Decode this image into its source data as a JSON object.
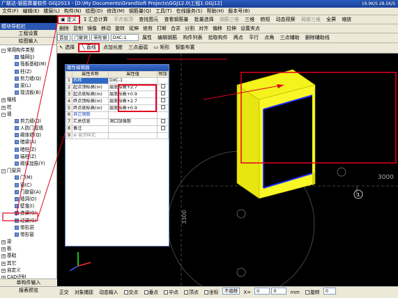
{
  "app": {
    "title": "广联达-钢筋算量软件 GGJ2013 - [D:\\My Documents\\GrandSoft Projects\\GGJ12.0\\工程1.GGJ12]",
    "net_down": "19.9K/S",
    "net_up": "28.5K/S"
  },
  "menu": [
    "文件(F)",
    "编辑(E)",
    "楼层(L)",
    "构件(N)",
    "绘图(D)",
    "修改(M)",
    "钢筋量(Q)",
    "工具(T)",
    "在线服务(S)",
    "帮助(H)",
    "版本号(B)"
  ],
  "toolbar1": {
    "define": "定义",
    "summary": "汇总计算",
    "flat_board": "平齐板顶",
    "find": "查找图元",
    "view_rebar": "查看钢筋量",
    "batch": "批量选择",
    "rebar_3d": "钢筋三维",
    "view3d": "三维",
    "top_view": "俯视",
    "dyn_view": "动态观察",
    "local_3d": "局部三维",
    "full": "全屏",
    "zoom": "缩放"
  },
  "toolbar2": [
    "删除",
    "复制",
    "镜像",
    "移动",
    "旋转",
    "延伸",
    "修剪",
    "打断",
    "合并",
    "分割",
    "对齐",
    "偏移",
    "拉伸",
    "设置夹点"
  ],
  "toolbar3": {
    "floor": "首层",
    "category": "门窗洞",
    "type": "带形窗",
    "item": "DXC-1",
    "property": "属性",
    "edit_rebar": "编辑钢筋",
    "comp_list": "构件列表",
    "pick": "拾取构件",
    "two_pt": "两点",
    "parallel": "平行",
    "point_angle": "点角",
    "three_pt_aux": "三点辅助",
    "del_aux": "删除辅助线"
  },
  "toolbar4": {
    "select": "选择",
    "line": "直线",
    "add_len": "点加长度",
    "three_arc": "三点画弧",
    "rect": "矩形",
    "smart": "智能布置"
  },
  "left": {
    "title": "模块导航栏",
    "tab1": "工程设置",
    "tab2": "绘图输入",
    "bottom1": "单构件输入",
    "bottom2": "报表预览",
    "tree": [
      {
        "t": "常用构件类型",
        "lvl": "p",
        "sign": "−"
      },
      {
        "t": "轴网(J)",
        "lvl": "c"
      },
      {
        "t": "筏板基础(M)",
        "lvl": "c"
      },
      {
        "t": "柱(Z)",
        "lvl": "c"
      },
      {
        "t": "剪力墙(Q)",
        "lvl": "c"
      },
      {
        "t": "梁(L)",
        "lvl": "c"
      },
      {
        "t": "现浇板(B)",
        "lvl": "c"
      },
      {
        "t": "轴线",
        "lvl": "p",
        "sign": "+"
      },
      {
        "t": "柱",
        "lvl": "p",
        "sign": "+"
      },
      {
        "t": "墙",
        "lvl": "p",
        "sign": "−"
      },
      {
        "t": "剪力墙(Q)",
        "lvl": "c"
      },
      {
        "t": "人防门框墙",
        "lvl": "c"
      },
      {
        "t": "砌体墙(Q)",
        "lvl": "c"
      },
      {
        "t": "暗梁(A)",
        "lvl": "c"
      },
      {
        "t": "暗柱(Z)",
        "lvl": "c"
      },
      {
        "t": "端柱(Z)",
        "lvl": "c"
      },
      {
        "t": "砌体加筋(Y)",
        "lvl": "c"
      },
      {
        "t": "门窗洞",
        "lvl": "p",
        "sign": "−"
      },
      {
        "t": "门(M)",
        "lvl": "c"
      },
      {
        "t": "窗(C)",
        "lvl": "c"
      },
      {
        "t": "门联窗(A)",
        "lvl": "c"
      },
      {
        "t": "墙洞(D)",
        "lvl": "c"
      },
      {
        "t": "壁龛(I)",
        "lvl": "c"
      },
      {
        "t": "连梁(G)",
        "lvl": "c"
      },
      {
        "t": "过梁(G)",
        "lvl": "c"
      },
      {
        "t": "带形洞",
        "lvl": "c"
      },
      {
        "t": "带形窗",
        "lvl": "c",
        "hl": true
      },
      {
        "t": "梁",
        "lvl": "p",
        "sign": "+"
      },
      {
        "t": "板",
        "lvl": "p",
        "sign": "+"
      },
      {
        "t": "基础",
        "lvl": "p",
        "sign": "+"
      },
      {
        "t": "其它",
        "lvl": "p",
        "sign": "+"
      },
      {
        "t": "自定义",
        "lvl": "p",
        "sign": "+"
      },
      {
        "t": "CAD识别",
        "lvl": "p",
        "sign": "+"
      }
    ]
  },
  "prop": {
    "title": "属性编辑器",
    "col_name": "属性名称",
    "col_val": "属性值",
    "col_add": "附加",
    "rows": [
      {
        "n": "1",
        "name": "名称",
        "val": "DXC-1",
        "cb": false,
        "sel": true
      },
      {
        "n": "2",
        "name": "起点顶标高(m)",
        "val": "层底标高+2.7",
        "cb": true
      },
      {
        "n": "3",
        "name": "起点底标高(m)",
        "val": "层底标高+0.9",
        "cb": true
      },
      {
        "n": "4",
        "name": "终点顶标高(m)",
        "val": "层底标高+2.7",
        "cb": true
      },
      {
        "n": "5",
        "name": "终点底标高(m)",
        "val": "层底标高+0.9",
        "cb": true
      },
      {
        "n": "6",
        "name": "其它钢筋",
        "val": "",
        "cb": false,
        "blue": true
      },
      {
        "n": "7",
        "name": "汇总信息",
        "val": "洞口加强筋",
        "cb": true
      },
      {
        "n": "8",
        "name": "备注",
        "val": "",
        "cb": true
      },
      {
        "n": "9",
        "name": "显示样式",
        "val": "",
        "cb": false,
        "plus": true
      }
    ]
  },
  "canvas": {
    "dim1": "3000",
    "dim2": "3300",
    "axis": "1"
  },
  "status": {
    "orth": "正交",
    "snap": "对象捕捉",
    "dyn": "动态输入",
    "intersect": "交点",
    "perp": "垂点",
    "mid": "中点",
    "vertex": "顶点",
    "coord": "坐标",
    "no_offset": "不偏移",
    "x": "X=",
    "x_val": "0",
    "y_val": "0",
    "unit": "mm",
    "rotate": "旋转",
    "rot_val": "0"
  }
}
